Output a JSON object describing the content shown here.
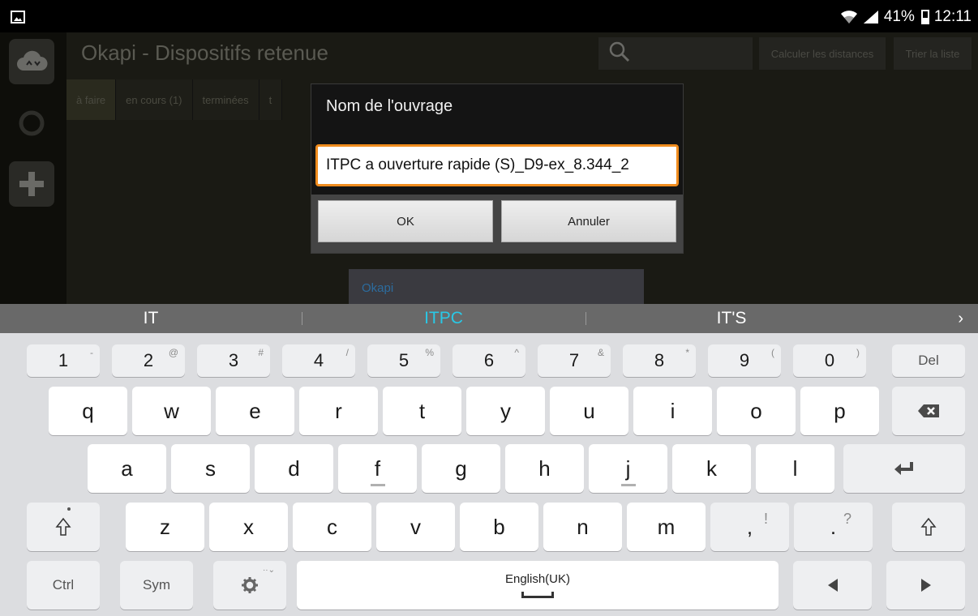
{
  "status_bar": {
    "battery_percent": "41%",
    "time": "12:11"
  },
  "app": {
    "title": "Okapi - Dispositifs retenue",
    "top_buttons": {
      "calc": "Calculer les distances",
      "trier": "Trier la liste"
    },
    "tabs": [
      {
        "label": "à faire"
      },
      {
        "label": "en cours (1)"
      },
      {
        "label": "terminées"
      },
      {
        "label": "t"
      }
    ],
    "background_panel_label": "Okapi"
  },
  "dialog": {
    "title": "Nom de l'ouvrage",
    "input_value": "ITPC a ouverture rapide (S)_D9-ex_8.344_2",
    "ok_label": "OK",
    "cancel_label": "Annuler"
  },
  "suggestions": [
    "IT",
    "ITPC",
    "IT'S"
  ],
  "keyboard": {
    "numbers": [
      {
        "main": "1",
        "sub": "-"
      },
      {
        "main": "2",
        "sub": "@"
      },
      {
        "main": "3",
        "sub": "#"
      },
      {
        "main": "4",
        "sub": "/"
      },
      {
        "main": "5",
        "sub": "%"
      },
      {
        "main": "6",
        "sub": "^"
      },
      {
        "main": "7",
        "sub": "&"
      },
      {
        "main": "8",
        "sub": "*"
      },
      {
        "main": "9",
        "sub": "("
      },
      {
        "main": "0",
        "sub": ")"
      }
    ],
    "del_label": "Del",
    "row1": [
      "q",
      "w",
      "e",
      "r",
      "t",
      "y",
      "u",
      "i",
      "o",
      "p"
    ],
    "row2": [
      "a",
      "s",
      "d",
      "f",
      "g",
      "h",
      "j",
      "k",
      "l"
    ],
    "row3": [
      "z",
      "x",
      "c",
      "v",
      "b",
      "n",
      "m"
    ],
    "comma": {
      "main": ",",
      "sub": "!"
    },
    "period": {
      "main": ".",
      "sub": "?"
    },
    "ctrl_label": "Ctrl",
    "sym_label": "Sym",
    "space_label": "English(UK)"
  }
}
